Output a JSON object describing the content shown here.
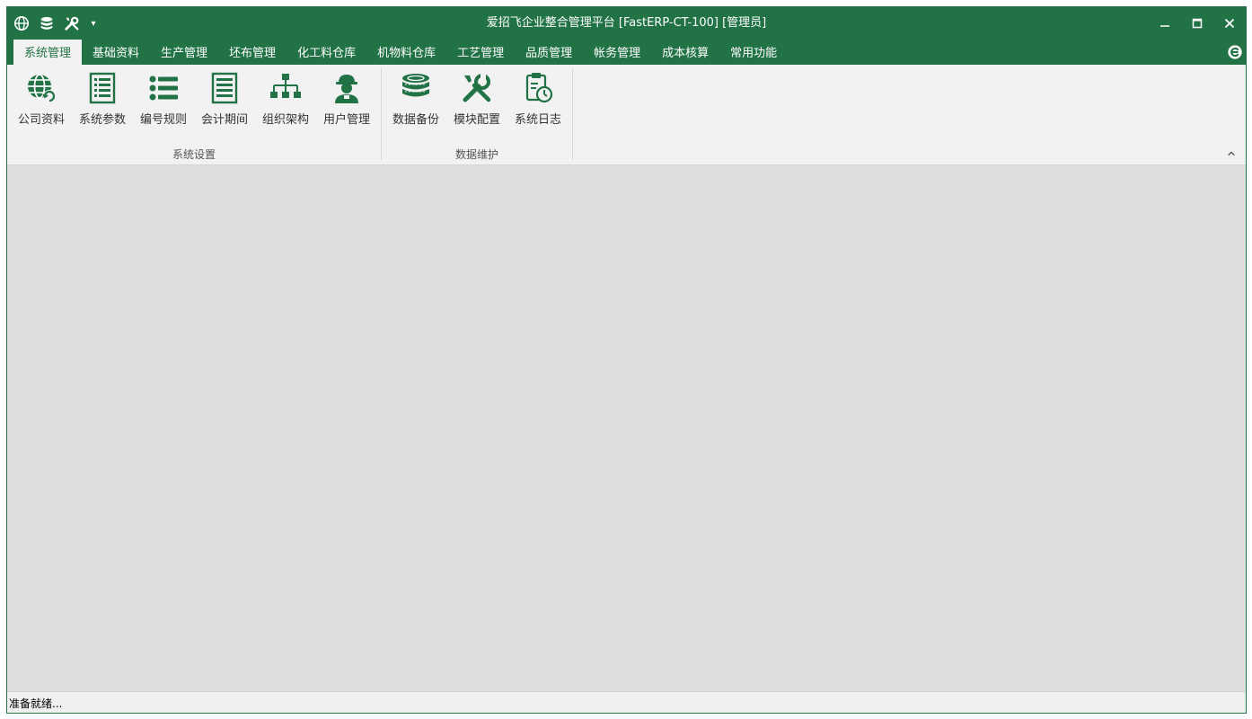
{
  "window": {
    "title": "爱招飞企业整合管理平台 [FastERP-CT-100] [管理员]"
  },
  "quick_access": {
    "items": [
      {
        "icon": "globe-icon"
      },
      {
        "icon": "database-icon"
      },
      {
        "icon": "tools-icon"
      }
    ],
    "dropdown_glyph": "▾"
  },
  "tabs": [
    {
      "label": "系统管理",
      "active": true
    },
    {
      "label": "基础资料"
    },
    {
      "label": "生产管理"
    },
    {
      "label": "坯布管理"
    },
    {
      "label": "化工料仓库"
    },
    {
      "label": "机物料仓库"
    },
    {
      "label": "工艺管理"
    },
    {
      "label": "品质管理"
    },
    {
      "label": "帐务管理"
    },
    {
      "label": "成本核算"
    },
    {
      "label": "常用功能"
    }
  ],
  "ribbon": {
    "groups": [
      {
        "label": "系统设置",
        "buttons": [
          {
            "label": "公司资料",
            "icon": "globe-refresh-icon"
          },
          {
            "label": "系统参数",
            "icon": "list-document-icon"
          },
          {
            "label": "编号规则",
            "icon": "bullet-list-icon"
          },
          {
            "label": "会计期间",
            "icon": "ledger-icon"
          },
          {
            "label": "组织架构",
            "icon": "org-chart-icon"
          },
          {
            "label": "用户管理",
            "icon": "user-worker-icon"
          }
        ]
      },
      {
        "label": "数据维护",
        "buttons": [
          {
            "label": "数据备份",
            "icon": "database-backup-icon"
          },
          {
            "label": "模块配置",
            "icon": "tools-icon"
          },
          {
            "label": "系统日志",
            "icon": "clipboard-clock-icon"
          }
        ]
      }
    ]
  },
  "status": {
    "text": "准备就绪..."
  },
  "colors": {
    "accent": "#217346",
    "ribbon_bg": "#f2f2f2",
    "content_bg": "#dedede"
  }
}
